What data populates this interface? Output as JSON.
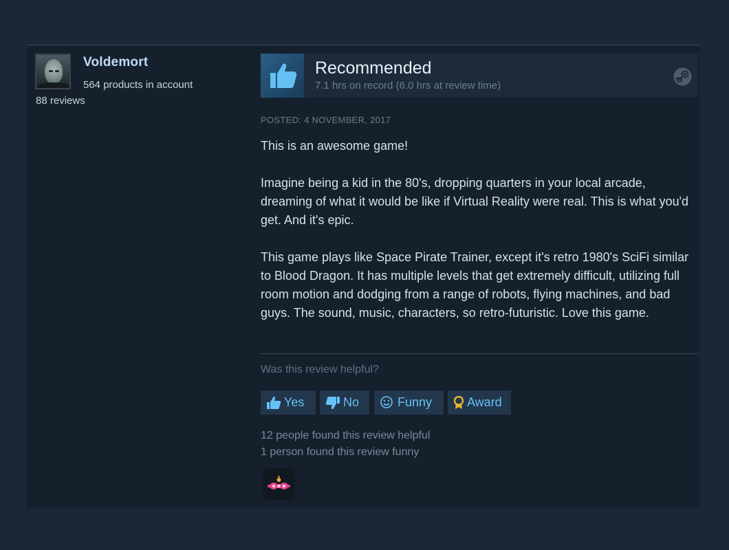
{
  "reviewer": {
    "name": "Voldemort",
    "products": "564 products in account",
    "reviews": "88 reviews"
  },
  "review": {
    "verdict": "Recommended",
    "hours": "7.1 hrs on record (6.0 hrs at review time)",
    "posted": "POSTED: 4 NOVEMBER, 2017",
    "paragraphs": [
      "This is an awesome game!",
      "Imagine being a kid in the 80's, dropping quarters in your local arcade, dreaming of what it would be like if Virtual Reality were real. This is what you'd get. And it's epic.",
      "This game plays like Space Pirate Trainer, except it's retro 1980's SciFi similar to Blood Dragon. It has multiple levels that get extremely difficult, utilizing full room motion and dodging from a range of robots, flying machines, and bad guys. The sound, music, characters, so retro-futuristic. Love this game."
    ]
  },
  "helpful": {
    "question": "Was this review helpful?",
    "buttons": {
      "yes": "Yes",
      "no": "No",
      "funny": "Funny",
      "award": "Award"
    },
    "stat_helpful": "12 people found this review helpful",
    "stat_funny": "1 person found this review funny"
  },
  "icons": {
    "avatar": "avatar-image",
    "thumb": "thumbs-up-icon",
    "steam": "steam-icon",
    "award_badge": "award-badge-icon"
  },
  "colors": {
    "accent": "#67c1f5",
    "name": "#c1dbf4",
    "background": "#16202d"
  }
}
